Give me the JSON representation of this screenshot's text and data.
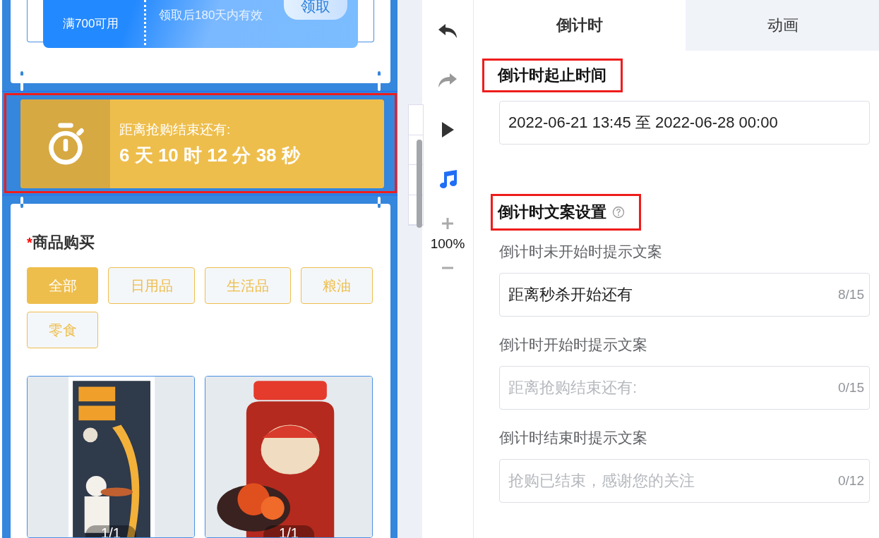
{
  "coupon": {
    "condition": "满700可用",
    "validity": "领取后180天内有效",
    "button": "领取"
  },
  "countdown": {
    "label": "距离抢购结束还有:",
    "value": "6 天 10 时 12 分 38 秒",
    "highlighted": true
  },
  "goods": {
    "title": "商品购买",
    "required_mark": "*",
    "categories": [
      {
        "label": "全部",
        "selected": true
      },
      {
        "label": "日用品",
        "selected": false
      },
      {
        "label": "生活品",
        "selected": false
      },
      {
        "label": "粮油",
        "selected": false
      },
      {
        "label": "零食",
        "selected": false
      }
    ],
    "products": [
      {
        "kind": "noodles",
        "counter": "1/1"
      },
      {
        "kind": "jar",
        "counter": "1/1"
      }
    ]
  },
  "toolbar": {
    "items": [
      {
        "kind": "undo",
        "disabled": false
      },
      {
        "kind": "redo",
        "disabled": true
      },
      {
        "kind": "play",
        "disabled": false
      },
      {
        "kind": "music",
        "disabled": false
      }
    ],
    "zoom": "100%"
  },
  "panel": {
    "tabs": [
      {
        "label": "倒计时",
        "selected": true
      },
      {
        "label": "动画",
        "selected": false
      }
    ],
    "sections": [
      {
        "title": "倒计时起止时间",
        "highlighted": true,
        "fields": [
          {
            "value": "2022-06-21 13:45 至 2022-06-28 00:00"
          }
        ]
      },
      {
        "title": "倒计时文案设置",
        "highlighted": true,
        "help": true,
        "fields": [
          {
            "label": "倒计时未开始时提示文案",
            "value": "距离秒杀开始还有",
            "counter": "8/15"
          },
          {
            "label": "倒计时开始时提示文案",
            "placeholder": "距离抢购结束还有:",
            "counter": "0/15"
          },
          {
            "label": "倒计时结束时提示文案",
            "placeholder": "抢购已结束，感谢您的关注",
            "counter": "0/12"
          }
        ]
      }
    ]
  }
}
